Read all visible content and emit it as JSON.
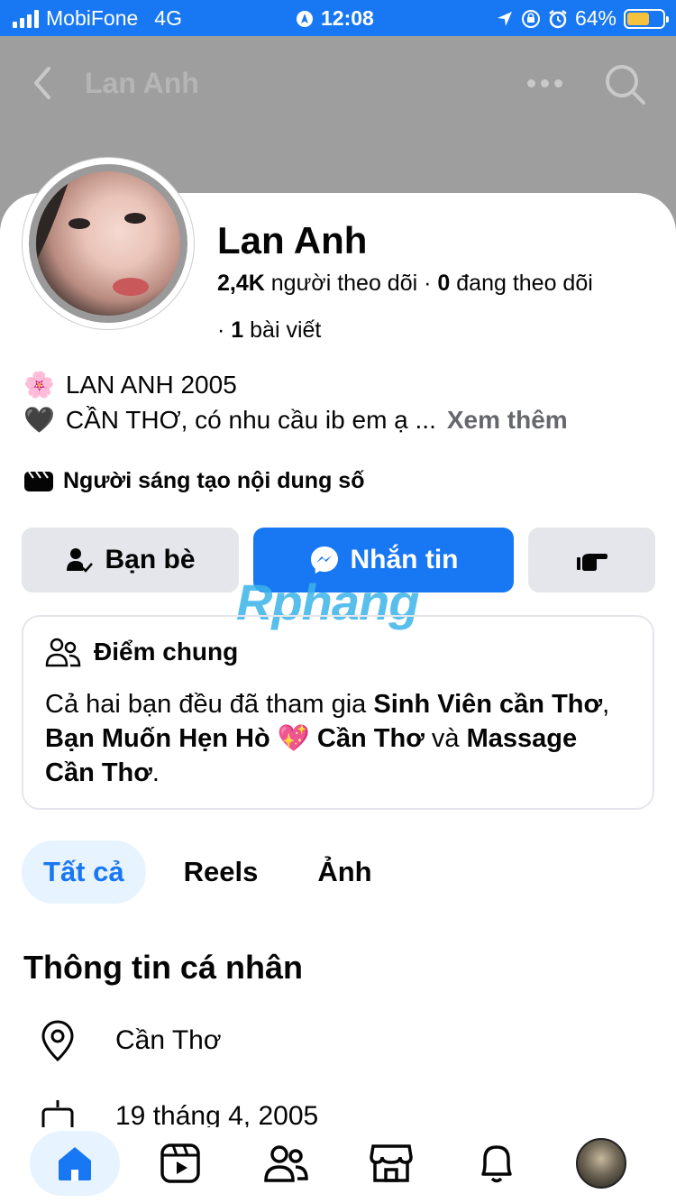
{
  "status_bar": {
    "carrier": "MobiFone",
    "network": "4G",
    "time": "12:08",
    "battery": "64%",
    "battery_level": 0.64
  },
  "header": {
    "title": "Lan Anh"
  },
  "profile": {
    "name": "Lan Anh",
    "followers_count": "2,4K",
    "followers_label": "người theo dõi",
    "following_count": "0",
    "following_label": "đang theo dõi",
    "posts_count": "1",
    "posts_label": "bài viết"
  },
  "bio": {
    "line1_emoji": "🌸",
    "line1": "LAN ANH 2005",
    "line2_emoji": "🖤",
    "line2": "CẦN THƠ, có nhu cầu ib em ạ ...",
    "see_more": "Xem thêm"
  },
  "creator_label": "Người sáng tạo nội dung số",
  "actions": {
    "friends": "Bạn bè",
    "message": "Nhắn tin"
  },
  "watermark": "Rphang",
  "mutual": {
    "title": "Điểm chung",
    "text_prefix": "Cả hai bạn đều đã tham gia ",
    "group1": "Sinh Viên cần Thơ",
    "sep1": ", ",
    "group2": "Bạn Muốn Hẹn Hò 💖 Cần Thơ",
    "sep2": " và ",
    "group3": "Massage Cần Thơ",
    "end": "."
  },
  "tabs": [
    "Tất cả",
    "Reels",
    "Ảnh"
  ],
  "about": {
    "title": "Thông tin cá nhân",
    "location": "Cần Thơ",
    "birthday": "19 tháng 4, 2005"
  },
  "colors": {
    "accent": "#1877f2",
    "header_gray": "#9e9e9e",
    "button_gray": "#e4e6eb"
  }
}
